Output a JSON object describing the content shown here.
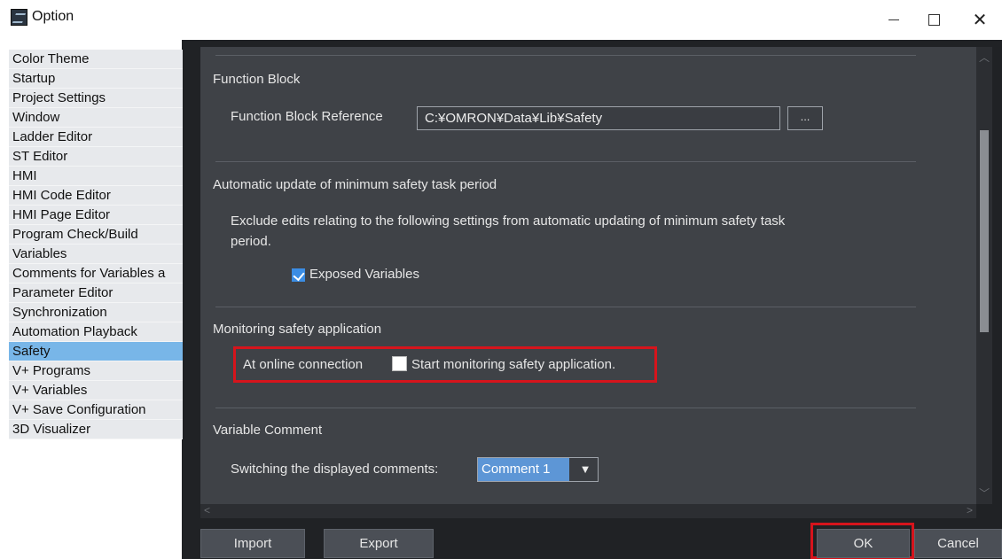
{
  "window": {
    "title": "Option",
    "minimize_glyph": "—",
    "close_glyph": "✕"
  },
  "sidebar": {
    "items": [
      {
        "label": "Color Theme"
      },
      {
        "label": "Startup"
      },
      {
        "label": "Project Settings"
      },
      {
        "label": "Window"
      },
      {
        "label": "Ladder Editor"
      },
      {
        "label": "ST Editor"
      },
      {
        "label": "HMI"
      },
      {
        "label": "HMI Code Editor"
      },
      {
        "label": "HMI Page Editor"
      },
      {
        "label": "Program Check/Build"
      },
      {
        "label": "Variables"
      },
      {
        "label": "Comments for Variables a"
      },
      {
        "label": "Parameter Editor"
      },
      {
        "label": "Synchronization"
      },
      {
        "label": "Automation Playback"
      },
      {
        "label": "Safety"
      },
      {
        "label": "V+ Programs"
      },
      {
        "label": "V+ Variables"
      },
      {
        "label": "V+ Save Configuration"
      },
      {
        "label": "3D Visualizer"
      }
    ],
    "selected": "Safety",
    "scroll_left_glyph": "<",
    "scroll_right_glyph": ">"
  },
  "content": {
    "function_block": {
      "title": "Function Block",
      "reference_label": "Function Block Reference",
      "reference_value": "C:¥OMRON¥Data¥Lib¥Safety",
      "browse_label": "..."
    },
    "auto_update": {
      "title": "Automatic update of minimum safety task period",
      "description_line1": "Exclude edits relating to the following settings from automatic updating of minimum safety task",
      "description_line2": "period.",
      "exposed_variables_label": "Exposed Variables",
      "exposed_variables_checked": true
    },
    "monitoring": {
      "title": "Monitoring safety application",
      "online_label": "At online connection",
      "start_label": "Start monitoring safety application.",
      "start_checked": false
    },
    "variable_comment": {
      "title": "Variable Comment",
      "switch_label": "Switching the displayed comments:",
      "selected_comment": "Comment 1",
      "dropdown_glyph": "▼"
    }
  },
  "buttons": {
    "import": "Import",
    "export": "Export",
    "ok": "OK",
    "cancel": "Cancel"
  },
  "colors": {
    "highlight": "#d6141c",
    "selection": "#78b6e8",
    "checkbox_accent": "#3b8de4",
    "panel_bg": "#3f4247"
  }
}
